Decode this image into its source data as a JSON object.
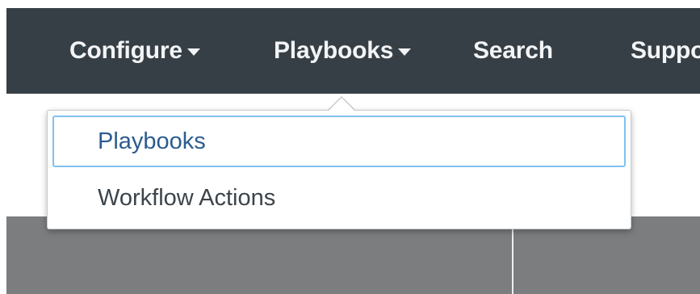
{
  "navbar": {
    "items": [
      {
        "label": "Configure",
        "has_caret": true
      },
      {
        "label": "Playbooks",
        "has_caret": true
      },
      {
        "label": "Search",
        "has_caret": false
      },
      {
        "label": "Suppo",
        "has_caret": false
      }
    ]
  },
  "dropdown": {
    "items": [
      {
        "label": "Playbooks",
        "highlighted": true
      },
      {
        "label": "Workflow Actions",
        "highlighted": false
      }
    ]
  },
  "colors": {
    "navbar_bg": "#373f46",
    "nav_text": "#f2f4f6",
    "highlight_border": "#7fc1ee",
    "highlight_text": "#2c5c8f",
    "menu_text": "#3c444b",
    "content_gray": "#7b7d7f"
  },
  "icons": {
    "caret": "caret-down-icon"
  }
}
